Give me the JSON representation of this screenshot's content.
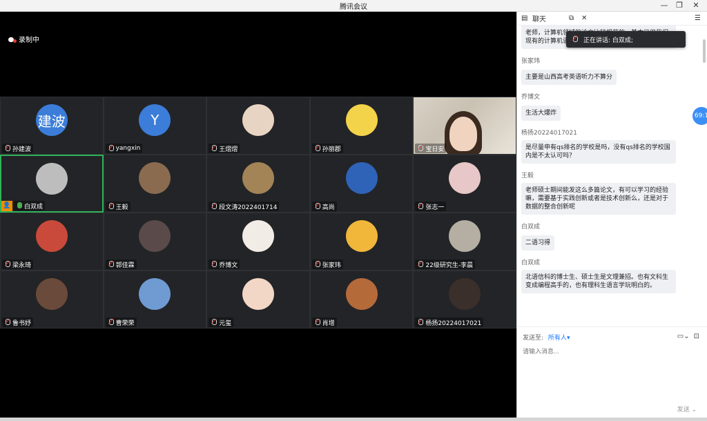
{
  "window": {
    "title": "腾讯会议",
    "min": "—",
    "max": "❐",
    "close": "✕"
  },
  "recording": {
    "label": "录制中"
  },
  "participants": [
    {
      "name": "孙建波",
      "avatar_text": "建波",
      "avatar_color": "#3b7dd8"
    },
    {
      "name": "yangxin",
      "avatar_text": "Y",
      "avatar_color": "#3b7dd8"
    },
    {
      "name": "王熠熠",
      "avatar_text": "",
      "avatar_color": "#e8d4c3"
    },
    {
      "name": "孙丽郡",
      "avatar_text": "",
      "avatar_color": "#f3d34a"
    },
    {
      "name": "宝日安",
      "avatar_text": "",
      "avatar_color": "#cfc7b8",
      "video": true
    },
    {
      "name": "白双成",
      "avatar_text": "",
      "avatar_color": "#bdbdbd",
      "active": true,
      "host": true,
      "mic_on": true
    },
    {
      "name": "王毅",
      "avatar_text": "",
      "avatar_color": "#8a6b4f"
    },
    {
      "name": "段文涛2022401714",
      "avatar_text": "",
      "avatar_color": "#a38457"
    },
    {
      "name": "高尚",
      "avatar_text": "",
      "avatar_color": "#2f63b8"
    },
    {
      "name": "张志一",
      "avatar_text": "",
      "avatar_color": "#e7c7c7"
    },
    {
      "name": "梁永琦",
      "avatar_text": "",
      "avatar_color": "#c94a3a"
    },
    {
      "name": "郭佳霖",
      "avatar_text": "",
      "avatar_color": "#5a4a4a"
    },
    {
      "name": "乔博文",
      "avatar_text": "",
      "avatar_color": "#f2ece6"
    },
    {
      "name": "张家玮",
      "avatar_text": "",
      "avatar_color": "#f0b73a"
    },
    {
      "name": "22级研究生-李晨",
      "avatar_text": "",
      "avatar_color": "#b5aea3"
    },
    {
      "name": "鲁书妤",
      "avatar_text": "",
      "avatar_color": "#6a4a3a"
    },
    {
      "name": "曹荣荣",
      "avatar_text": "",
      "avatar_color": "#6f9bd2"
    },
    {
      "name": "元玺",
      "avatar_text": "",
      "avatar_color": "#f2d6c6"
    },
    {
      "name": "肖增",
      "avatar_text": "",
      "avatar_color": "#b56a3a"
    },
    {
      "name": "杨扬20224017021",
      "avatar_text": "",
      "avatar_color": "#3a2f2a"
    }
  ],
  "chat": {
    "title": "聊天",
    "speaking_label": "正在讲话: 白双成;",
    "side_badge": "69:1",
    "top_partial": "老师，计算机领域的论文比较规范的，基本已用我们现有的计算机语言来描述的一种的。",
    "messages": [
      {
        "sender": "张家玮",
        "text": "主要是山西高考英语听力不算分"
      },
      {
        "sender": "乔博文",
        "text": "生活大爆炸"
      },
      {
        "sender": "杨扬20224017021",
        "text": "是尽量申有qs排名的学校是吗，没有qs排名的学校国内是不太认可吗？"
      },
      {
        "sender": "王毅",
        "text": "老师硕士期间能发这么多篇论文，有可以学习的经验嘛，需要基于实践创新或者是技术创新么，还是对于数据的整合创新呢"
      },
      {
        "sender": "白双成",
        "text": "二语习得"
      },
      {
        "sender": "白双成",
        "text": "北语信科的博士生、硕士生是文理兼招。也有文科生变成编程高手的，也有理科生语言学玩明白的。"
      }
    ],
    "send_to_label": "发送至:",
    "send_to_target": "所有人",
    "input_placeholder": "请输入消息...",
    "send_label": "发送"
  }
}
